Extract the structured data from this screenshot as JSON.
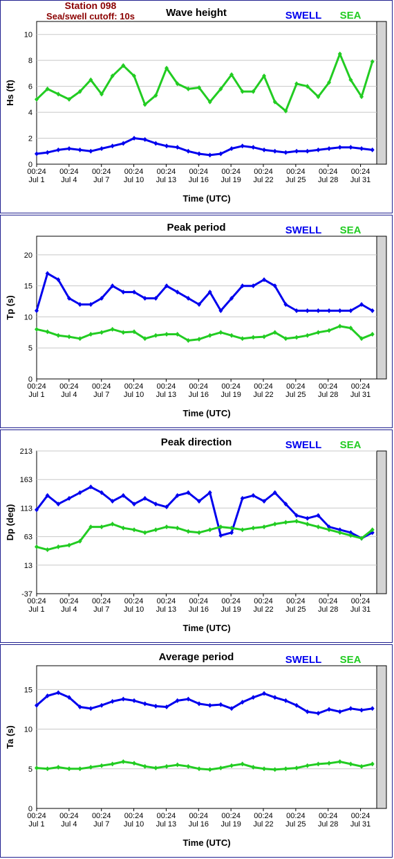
{
  "header": {
    "station": "Station 098",
    "cutoff": "Sea/swell cutoff: 10s"
  },
  "legend": {
    "swell": "SWELL",
    "sea": "SEA"
  },
  "colors": {
    "swell": "#0000ee",
    "sea": "#22cc22",
    "background_band": "#d4d4d4",
    "grid": "#c8c8c8",
    "border": "#1f1f8f",
    "station_text": "#8b0000"
  },
  "chart_data": [
    {
      "type": "line",
      "title": "Wave height",
      "ylabel": "Hs (ft)",
      "xlabel": "Time (UTC)",
      "ylim": [
        0,
        11
      ],
      "yticks": [
        "0",
        "2",
        "4",
        "6",
        "8",
        "10"
      ],
      "xticks_top": [
        "00:24",
        "00:24",
        "00:24",
        "00:24",
        "00:24",
        "00:24",
        "00:24",
        "00:24",
        "00:24",
        "00:24",
        "00:24"
      ],
      "xticks_bottom": [
        "Jul 1",
        "Jul 4",
        "Jul 7",
        "Jul 10",
        "Jul 13",
        "Jul 16",
        "Jul 19",
        "Jul 22",
        "Jul 25",
        "Jul 28",
        "Jul 31"
      ],
      "x_days": [
        1,
        2,
        3,
        4,
        5,
        6,
        7,
        8,
        9,
        10,
        11,
        12,
        13,
        14,
        15,
        16,
        17,
        18,
        19,
        20,
        21,
        22,
        23,
        24,
        25,
        26,
        27,
        28,
        29,
        30,
        31,
        32
      ],
      "grid": true,
      "series": [
        {
          "name": "SWELL",
          "values": [
            0.8,
            0.9,
            1.1,
            1.2,
            1.1,
            1.0,
            1.2,
            1.4,
            1.6,
            2.0,
            1.9,
            1.6,
            1.4,
            1.3,
            1.0,
            0.8,
            0.7,
            0.8,
            1.2,
            1.4,
            1.3,
            1.1,
            1.0,
            0.9,
            1.0,
            1.0,
            1.1,
            1.2,
            1.3,
            1.3,
            1.2,
            1.1
          ]
        },
        {
          "name": "SEA",
          "values": [
            5.0,
            5.8,
            5.4,
            5.0,
            5.6,
            6.5,
            5.4,
            6.8,
            7.6,
            6.8,
            4.6,
            5.3,
            7.4,
            6.2,
            5.8,
            5.9,
            4.8,
            5.8,
            6.9,
            5.6,
            5.6,
            6.8,
            4.8,
            4.1,
            6.2,
            6.0,
            5.2,
            6.3,
            8.5,
            6.5,
            5.2,
            7.9
          ]
        }
      ]
    },
    {
      "type": "line",
      "title": "Peak period",
      "ylabel": "Tp (s)",
      "xlabel": "Time (UTC)",
      "ylim": [
        0,
        23
      ],
      "yticks": [
        "0",
        "5",
        "10",
        "15",
        "20"
      ],
      "xticks_top": [
        "00:24",
        "00:24",
        "00:24",
        "00:24",
        "00:24",
        "00:24",
        "00:24",
        "00:24",
        "00:24",
        "00:24",
        "00:24"
      ],
      "xticks_bottom": [
        "Jul 1",
        "Jul 4",
        "Jul 7",
        "Jul 10",
        "Jul 13",
        "Jul 16",
        "Jul 19",
        "Jul 22",
        "Jul 25",
        "Jul 28",
        "Jul 31"
      ],
      "x_days": [
        1,
        2,
        3,
        4,
        5,
        6,
        7,
        8,
        9,
        10,
        11,
        12,
        13,
        14,
        15,
        16,
        17,
        18,
        19,
        20,
        21,
        22,
        23,
        24,
        25,
        26,
        27,
        28,
        29,
        30,
        31,
        32
      ],
      "grid": true,
      "series": [
        {
          "name": "SWELL",
          "values": [
            11,
            17,
            16,
            13,
            12,
            12,
            13,
            15,
            14,
            14,
            13,
            13,
            15,
            14,
            13,
            12,
            14,
            11,
            13,
            15,
            15,
            16,
            15,
            12,
            11,
            11,
            11,
            11,
            11,
            11,
            12,
            11
          ]
        },
        {
          "name": "SEA",
          "values": [
            8,
            7.6,
            7,
            6.8,
            6.5,
            7.2,
            7.5,
            8,
            7.5,
            7.6,
            6.5,
            7,
            7.2,
            7.2,
            6.2,
            6.4,
            7,
            7.5,
            7,
            6.5,
            6.7,
            6.8,
            7.5,
            6.5,
            6.7,
            7,
            7.5,
            7.8,
            8.5,
            8.2,
            6.5,
            7.2
          ]
        }
      ]
    },
    {
      "type": "line",
      "title": "Peak direction",
      "ylabel": "Dp (deg)",
      "xlabel": "Time (UTC)",
      "ylim": [
        -37,
        213
      ],
      "yticks": [
        "-37",
        "13",
        "63",
        "113",
        "163",
        "213"
      ],
      "xticks_top": [
        "00:24",
        "00:24",
        "00:24",
        "00:24",
        "00:24",
        "00:24",
        "00:24",
        "00:24",
        "00:24",
        "00:24",
        "00:24"
      ],
      "xticks_bottom": [
        "Jul 1",
        "Jul 4",
        "Jul 7",
        "Jul 10",
        "Jul 13",
        "Jul 16",
        "Jul 19",
        "Jul 22",
        "Jul 25",
        "Jul 28",
        "Jul 31"
      ],
      "x_days": [
        1,
        2,
        3,
        4,
        5,
        6,
        7,
        8,
        9,
        10,
        11,
        12,
        13,
        14,
        15,
        16,
        17,
        18,
        19,
        20,
        21,
        22,
        23,
        24,
        25,
        26,
        27,
        28,
        29,
        30,
        31,
        32
      ],
      "grid": true,
      "series": [
        {
          "name": "SWELL",
          "values": [
            110,
            135,
            120,
            130,
            140,
            150,
            140,
            125,
            135,
            120,
            130,
            120,
            115,
            135,
            140,
            125,
            140,
            65,
            70,
            130,
            135,
            125,
            140,
            120,
            100,
            95,
            100,
            80,
            75,
            70,
            60,
            70
          ]
        },
        {
          "name": "SEA",
          "values": [
            45,
            40,
            45,
            48,
            55,
            80,
            80,
            85,
            78,
            75,
            70,
            75,
            80,
            78,
            72,
            70,
            75,
            80,
            78,
            75,
            78,
            80,
            85,
            88,
            90,
            85,
            80,
            75,
            70,
            65,
            60,
            75
          ]
        }
      ]
    },
    {
      "type": "line",
      "title": "Average period",
      "ylabel": "Ta (s)",
      "xlabel": "Time (UTC)",
      "ylim": [
        0,
        18
      ],
      "yticks": [
        "0",
        "5",
        "10",
        "15"
      ],
      "xticks_top": [
        "00:24",
        "00:24",
        "00:24",
        "00:24",
        "00:24",
        "00:24",
        "00:24",
        "00:24",
        "00:24",
        "00:24",
        "00:24"
      ],
      "xticks_bottom": [
        "Jul 1",
        "Jul 4",
        "Jul 7",
        "Jul 10",
        "Jul 13",
        "Jul 16",
        "Jul 19",
        "Jul 22",
        "Jul 25",
        "Jul 28",
        "Jul 31"
      ],
      "x_days": [
        1,
        2,
        3,
        4,
        5,
        6,
        7,
        8,
        9,
        10,
        11,
        12,
        13,
        14,
        15,
        16,
        17,
        18,
        19,
        20,
        21,
        22,
        23,
        24,
        25,
        26,
        27,
        28,
        29,
        30,
        31,
        32
      ],
      "grid": true,
      "series": [
        {
          "name": "SWELL",
          "values": [
            13.0,
            14.2,
            14.6,
            14.0,
            12.8,
            12.6,
            13.0,
            13.5,
            13.8,
            13.6,
            13.2,
            12.9,
            12.8,
            13.6,
            13.8,
            13.2,
            13.0,
            13.1,
            12.6,
            13.4,
            14.0,
            14.5,
            14.0,
            13.6,
            13.0,
            12.2,
            12.0,
            12.5,
            12.2,
            12.6,
            12.4,
            12.6
          ]
        },
        {
          "name": "SEA",
          "values": [
            5.1,
            5.0,
            5.2,
            5.0,
            5.0,
            5.2,
            5.4,
            5.6,
            5.9,
            5.7,
            5.3,
            5.1,
            5.3,
            5.5,
            5.3,
            5.0,
            4.9,
            5.1,
            5.4,
            5.6,
            5.2,
            5.0,
            4.9,
            5.0,
            5.1,
            5.4,
            5.6,
            5.7,
            5.9,
            5.6,
            5.3,
            5.6
          ]
        }
      ]
    }
  ]
}
